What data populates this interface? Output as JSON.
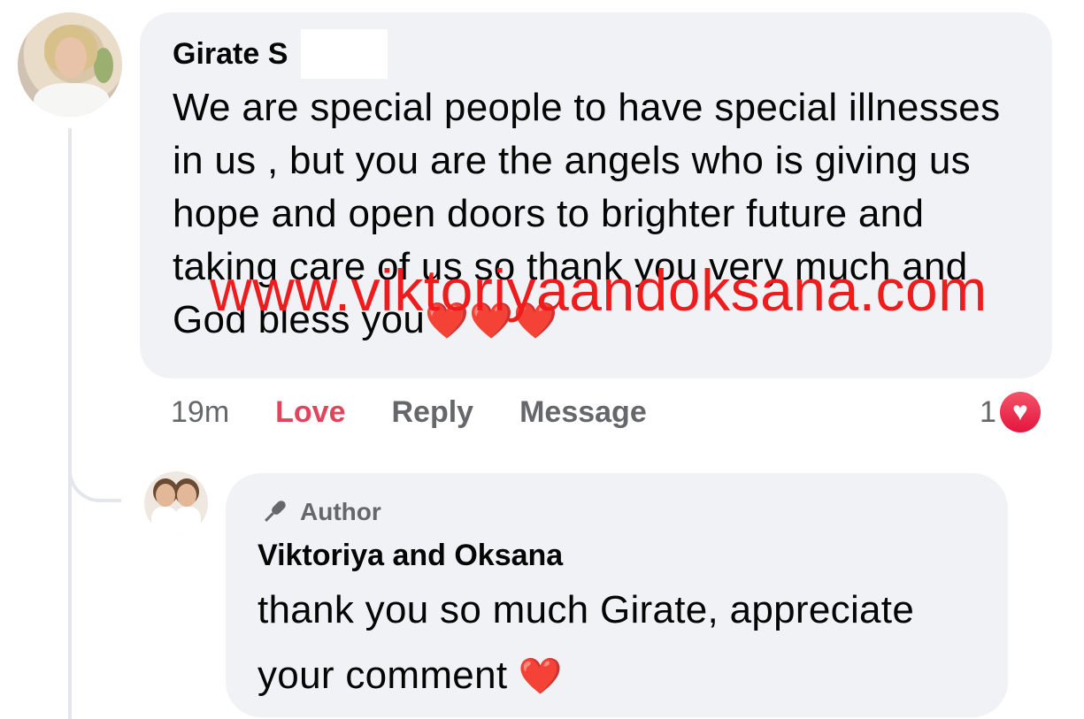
{
  "comment": {
    "author": "Girate S",
    "text": "We are special people to have special illnesses in us , but you are the angels who is giving us hope and open doors to brighter future and taking care of us so thank you very much and God bless you",
    "emoji": "❤️❤️❤️",
    "time": "19m",
    "actions": {
      "love": "Love",
      "reply": "Reply",
      "message": "Message"
    },
    "reaction_count": "1",
    "reaction_icon": "love-reaction-icon"
  },
  "reply": {
    "badge": "Author",
    "author": "Viktoriya and Oksana",
    "text": "thank you so much Girate, appreciate your comment",
    "emoji": "❤️"
  },
  "watermark": "www.viktoriyaandoksana.com",
  "colors": {
    "love_action": "#e0455b",
    "watermark": "#ee1c1c",
    "bubble": "#f0f2f5",
    "muted": "#65676b"
  }
}
